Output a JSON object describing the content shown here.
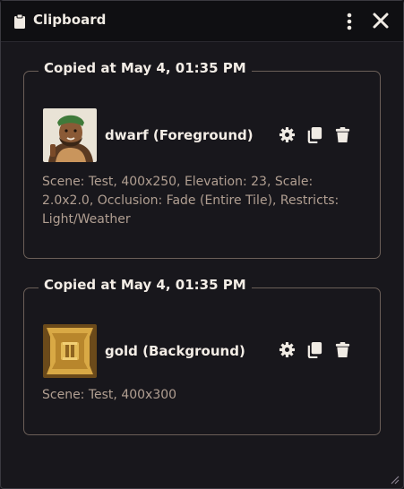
{
  "window": {
    "title": "Clipboard",
    "title_icon": "clipboard-icon"
  },
  "entries": [
    {
      "copied_label": "Copied at May 4, 01:35 PM",
      "name": "dwarf (Foreground)",
      "thumbnail": "dwarf-portrait",
      "description": "Scene: Test, 400x250, Elevation: 23, Scale: 2.0x2.0, Occlusion: Fade (Entire Tile), Restricts: Light/Weather"
    },
    {
      "copied_label": "Copied at May 4, 01:35 PM",
      "name": "gold (Background)",
      "thumbnail": "gold-pillar-token",
      "description": "Scene: Test, 400x300"
    }
  ],
  "icons": {
    "settings": "gear-icon",
    "copy": "copy-icon",
    "delete": "trash-icon",
    "menu": "kebab-menu-icon",
    "close": "close-icon"
  },
  "colors": {
    "background": "#18171c",
    "titlebar": "#0f0f12",
    "card_border": "#6b5f58",
    "text_primary": "#f3ede6",
    "text_muted": "#b19f92"
  }
}
